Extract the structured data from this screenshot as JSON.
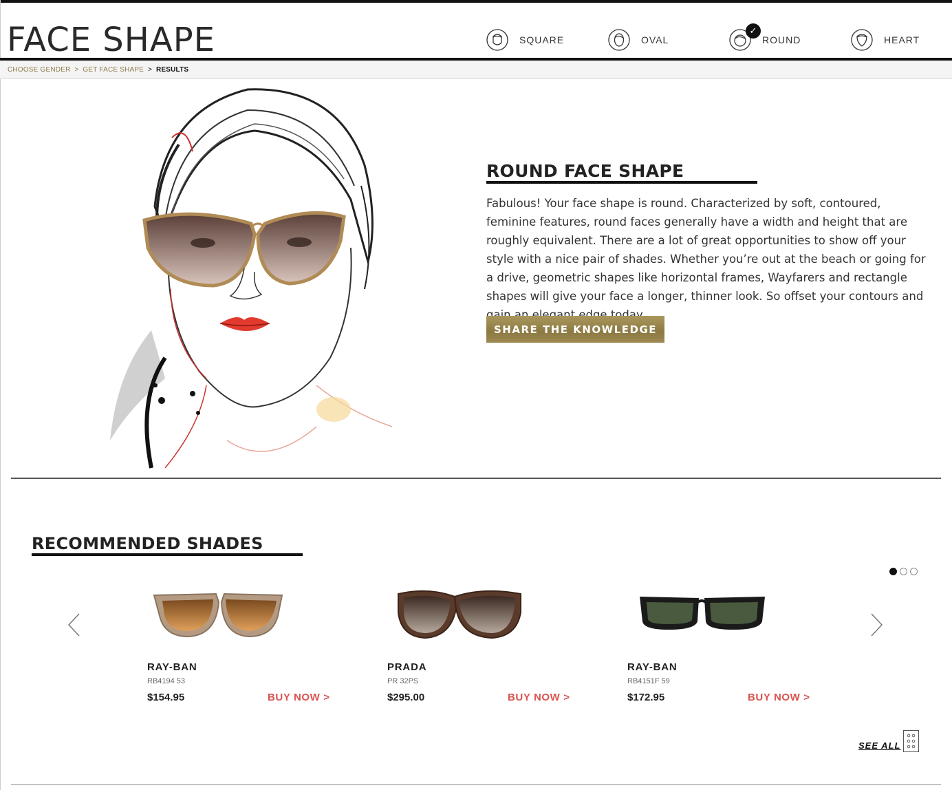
{
  "header": {
    "title": "FACE SHAPE",
    "shapes": [
      {
        "label": "SQUARE",
        "icon": "square-face-icon",
        "selected": false
      },
      {
        "label": "OVAL",
        "icon": "oval-face-icon",
        "selected": false
      },
      {
        "label": "ROUND",
        "icon": "round-face-icon",
        "selected": true
      },
      {
        "label": "HEART",
        "icon": "heart-face-icon",
        "selected": false
      }
    ]
  },
  "breadcrumb": {
    "items": [
      "CHOOSE GENDER",
      "GET FACE SHAPE",
      "RESULTS"
    ],
    "separator": ">"
  },
  "result": {
    "heading": "ROUND FACE SHAPE",
    "description": "Fabulous! Your face shape is round. Characterized by soft, contoured, feminine features, round faces generally have a width and height that are roughly equivalent. There are a lot of great opportunities to show off your style with a nice pair of shades. Whether you’re out at the beach or going for a drive, geometric shapes like horizontal frames, Wayfarers and rectangle shapes will give your face a longer, thinner look. So offset your contours and gain an elegant edge today.",
    "share_label": "SHARE THE KNOWLEDGE"
  },
  "recommended": {
    "heading": "RECOMMENDED SHADES",
    "page_count": 3,
    "active_page": 0,
    "products": [
      {
        "brand": "RAY-BAN",
        "model": "RB4194 53",
        "price": "$154.95",
        "buy_label": "BUY NOW >"
      },
      {
        "brand": "PRADA",
        "model": "PR 32PS",
        "price": "$295.00",
        "buy_label": "BUY NOW >"
      },
      {
        "brand": "RAY-BAN",
        "model": "RB4151F 59",
        "price": "$172.95",
        "buy_label": "BUY NOW >"
      }
    ],
    "see_all_label": "SEE ALL"
  },
  "colors": {
    "accent_gold": "#8d7a4a",
    "buy_red": "#d9534f",
    "text_dark": "#222222"
  }
}
